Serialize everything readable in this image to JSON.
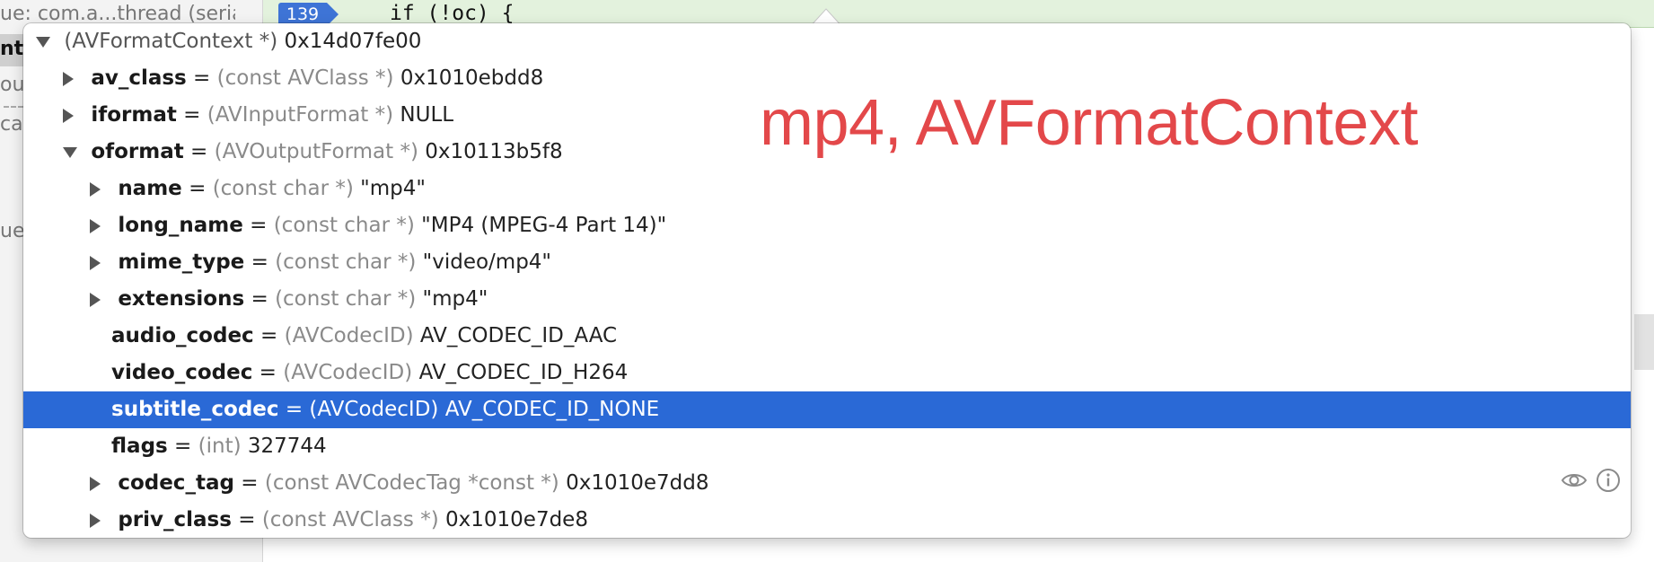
{
  "sidebar": {
    "queue_label": "ue: com.a...thread (serial)",
    "fragments": [
      "ntr",
      "ouc",
      "cati",
      "ue:"
    ]
  },
  "editor": {
    "line_number": "139",
    "code": "if (!oc) {"
  },
  "annotation": "mp4, AVFormatContext",
  "variables": {
    "root": {
      "type": "(AVFormatContext *)",
      "value": "0x14d07fe00"
    },
    "rows": [
      {
        "name": "av_class",
        "type": "(const AVClass *)",
        "value": "0x1010ebdd8"
      },
      {
        "name": "iformat",
        "type": "(AVInputFormat *)",
        "value": "NULL"
      },
      {
        "name": "oformat",
        "type": "(AVOutputFormat *)",
        "value": "0x10113b5f8"
      },
      {
        "name": "name",
        "type": "(const char *)",
        "value": "\"mp4\""
      },
      {
        "name": "long_name",
        "type": "(const char *)",
        "value": "\"MP4 (MPEG-4 Part 14)\""
      },
      {
        "name": "mime_type",
        "type": "(const char *)",
        "value": "\"video/mp4\""
      },
      {
        "name": "extensions",
        "type": "(const char *)",
        "value": "\"mp4\""
      },
      {
        "name": "audio_codec",
        "type": "(AVCodecID)",
        "value": "AV_CODEC_ID_AAC"
      },
      {
        "name": "video_codec",
        "type": "(AVCodecID)",
        "value": "AV_CODEC_ID_H264"
      },
      {
        "name": "subtitle_codec",
        "type": "(AVCodecID)",
        "value": "AV_CODEC_ID_NONE"
      },
      {
        "name": "flags",
        "type": "(int)",
        "value": "327744"
      },
      {
        "name": "codec_tag",
        "type": "(const AVCodecTag *const *)",
        "value": "0x1010e7dd8"
      },
      {
        "name": "priv_class",
        "type": "(const AVClass *)",
        "value": "0x1010e7de8"
      }
    ]
  },
  "icons": {
    "quicklook": "eye-icon",
    "info": "info-icon"
  },
  "colors": {
    "selection": "#2a69d6",
    "annotation": "#e3484a",
    "line_badge": "#3e74d6"
  }
}
